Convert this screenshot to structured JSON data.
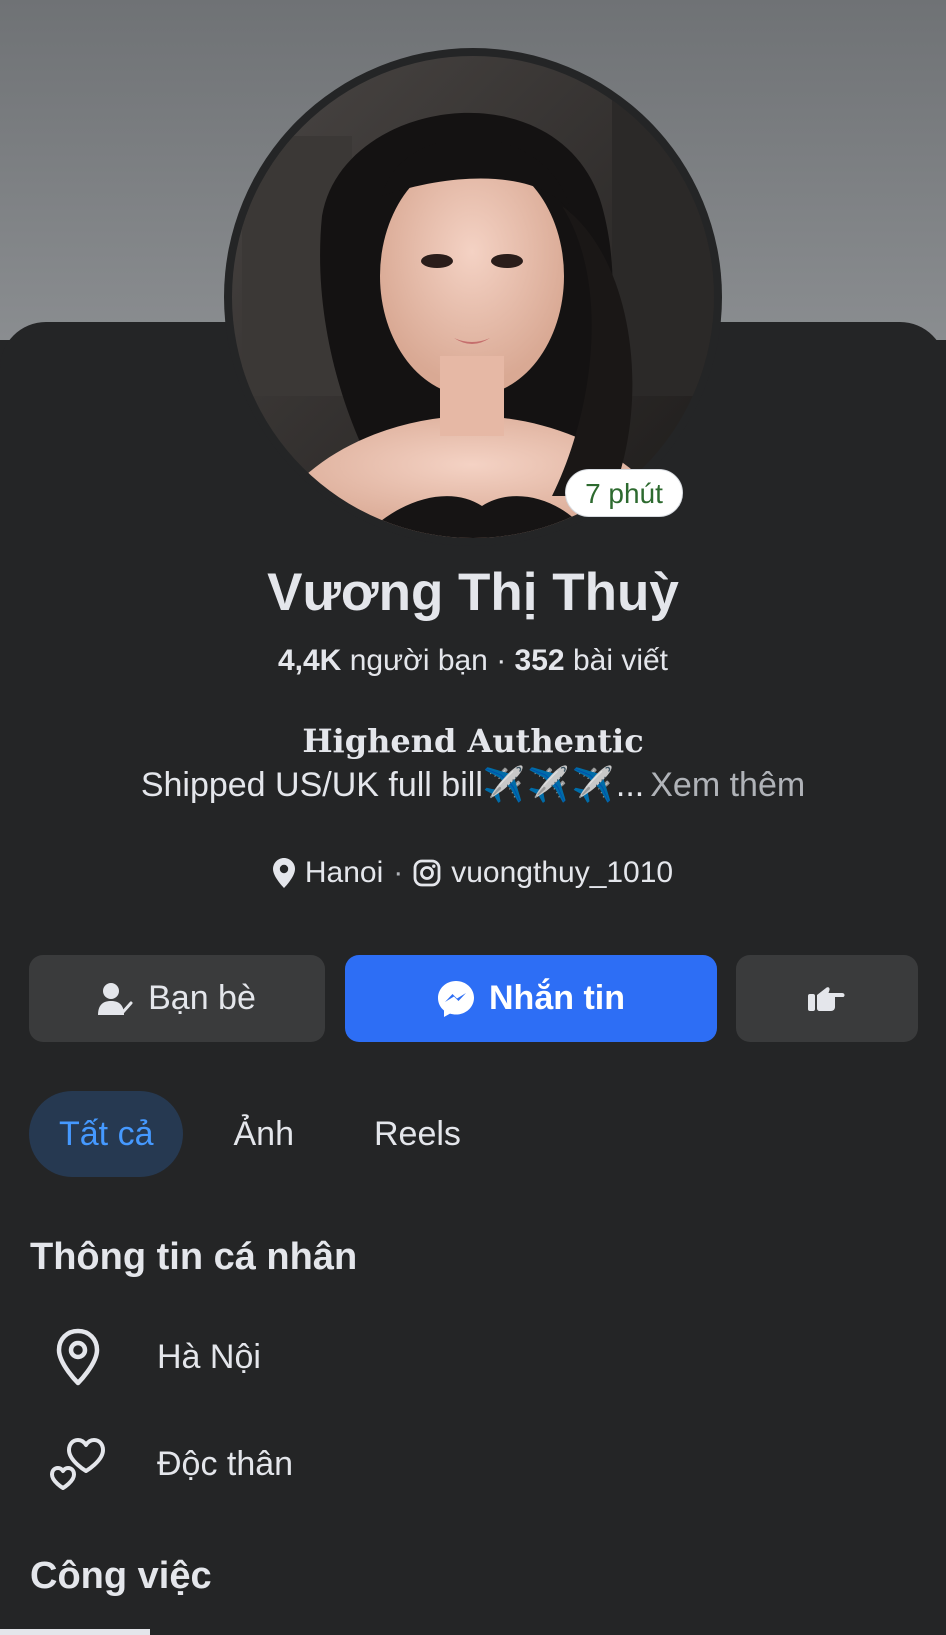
{
  "profile": {
    "name": "Vương Thị Thuỳ",
    "status_badge": "7 phút",
    "friends_count": "4,4K",
    "friends_label": "người bạn",
    "posts_count": "352",
    "posts_label": "bài viết",
    "bio_title": "Highend Authentic",
    "bio_text": "Shipped US/UK full bill",
    "bio_emoji": "✈️✈️✈️",
    "bio_ellipsis": "...",
    "see_more": "Xem thêm",
    "location": "Hanoi",
    "instagram": "vuongthuy_1010"
  },
  "actions": {
    "friends_label": "Bạn bè",
    "message_label": "Nhắn tin"
  },
  "tabs": [
    {
      "label": "Tất cả",
      "active": true
    },
    {
      "label": "Ảnh",
      "active": false
    },
    {
      "label": "Reels",
      "active": false
    }
  ],
  "personal_info": {
    "title": "Thông tin cá nhân",
    "items": [
      {
        "icon": "location-pin-icon",
        "label": "Hà Nội"
      },
      {
        "icon": "hearts-icon",
        "label": "Độc thân"
      }
    ]
  },
  "work": {
    "title": "Công việc"
  },
  "colors": {
    "background": "#242526",
    "primary_button": "#2d6ef5",
    "active_tab_bg": "#263951",
    "active_tab_text": "#4599ff"
  }
}
